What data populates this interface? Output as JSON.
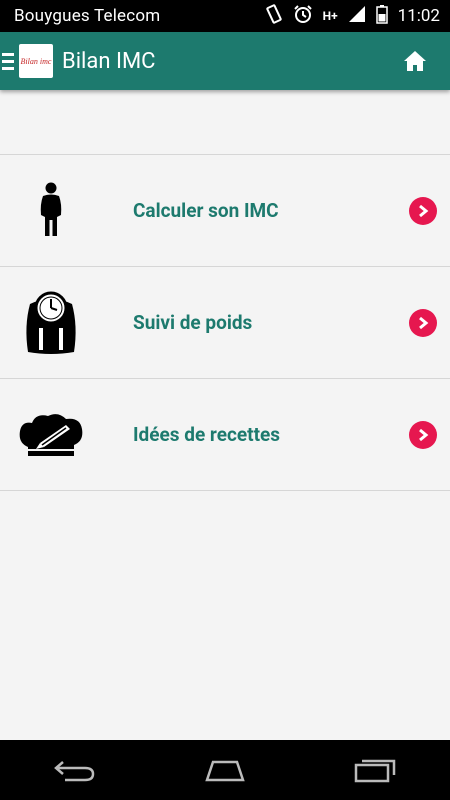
{
  "status_bar": {
    "carrier": "Bouygues Telecom",
    "network": "H+",
    "time": "11:02"
  },
  "app_bar": {
    "logo_text": "Bilan imc",
    "title": "Bilan IMC"
  },
  "menu": [
    {
      "label": "Calculer son IMC",
      "icon": "person-icon"
    },
    {
      "label": "Suivi de poids",
      "icon": "scale-icon"
    },
    {
      "label": "Idées de recettes",
      "icon": "chef-hat-icon"
    }
  ],
  "colors": {
    "primary": "#1d7a6e",
    "accent": "#e6174f"
  }
}
